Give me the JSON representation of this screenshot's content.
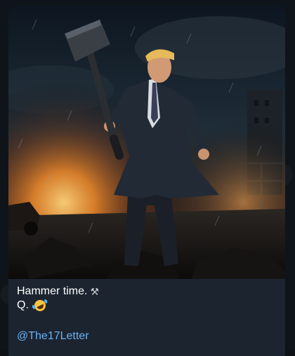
{
  "message": {
    "photo_icon": "image-photo",
    "caption_line1": "Hammer time.",
    "caption_line1_emoji": "hammer-icon",
    "caption_line2": "Q.",
    "caption_line2_emoji": "rolling-laughing-emoji-icon",
    "channel_link": "@The17Letter"
  },
  "colors": {
    "bubble": "#1c2430",
    "link": "#6ab3f3",
    "text": "#ffffff"
  }
}
